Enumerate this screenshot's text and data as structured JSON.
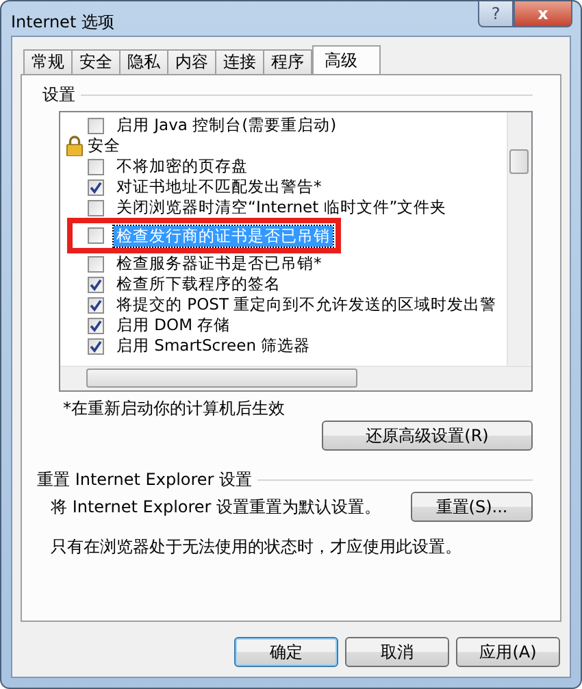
{
  "window": {
    "title": "Internet 选项",
    "help_button": "?",
    "close_button": "x"
  },
  "tabs": [
    {
      "label": "常规",
      "selected": false
    },
    {
      "label": "安全",
      "selected": false
    },
    {
      "label": "隐私",
      "selected": false
    },
    {
      "label": "内容",
      "selected": false
    },
    {
      "label": "连接",
      "selected": false
    },
    {
      "label": "程序",
      "selected": false
    },
    {
      "label": "高级",
      "selected": true
    }
  ],
  "settings": {
    "title": "设置",
    "items": [
      {
        "kind": "checkbox",
        "label": "启用 Java 控制台(需要重启动)",
        "checked": false,
        "selected": false
      },
      {
        "kind": "category",
        "label": "安全"
      },
      {
        "kind": "checkbox",
        "label": "不将加密的页存盘",
        "checked": false,
        "selected": false
      },
      {
        "kind": "checkbox",
        "label": "对证书地址不匹配发出警告*",
        "checked": true,
        "selected": false
      },
      {
        "kind": "checkbox",
        "label": "关闭浏览器时清空“Internet 临时文件”文件夹",
        "checked": false,
        "selected": false
      },
      {
        "kind": "checkbox",
        "label": "检查发行商的证书是否已吊销",
        "checked": false,
        "selected": true,
        "highlighted": true
      },
      {
        "kind": "checkbox",
        "label": "检查服务器证书是否已吊销*",
        "checked": false,
        "selected": false
      },
      {
        "kind": "checkbox",
        "label": "检查所下载程序的签名",
        "checked": true,
        "selected": false
      },
      {
        "kind": "checkbox",
        "label": "将提交的 POST 重定向到不允许发送的区域时发出警",
        "checked": true,
        "selected": false
      },
      {
        "kind": "checkbox",
        "label": "启用 DOM 存储",
        "checked": true,
        "selected": false
      },
      {
        "kind": "checkbox",
        "label": "启用 SmartScreen 筛选器",
        "checked": true,
        "selected": false
      }
    ],
    "note": "*在重新启动你的计算机后生效",
    "restore_button": "还原高级设置(R)"
  },
  "reset": {
    "title": "重置 Internet Explorer 设置",
    "description": "将 Internet Explorer 设置重置为默认设置。",
    "button": "重置(S)...",
    "note": "只有在浏览器处于无法使用的状态时，才应使用此设置。"
  },
  "buttons": [
    {
      "label": "确定",
      "default": true
    },
    {
      "label": "取消",
      "default": false
    },
    {
      "label": "应用(A)",
      "default": false
    }
  ]
}
